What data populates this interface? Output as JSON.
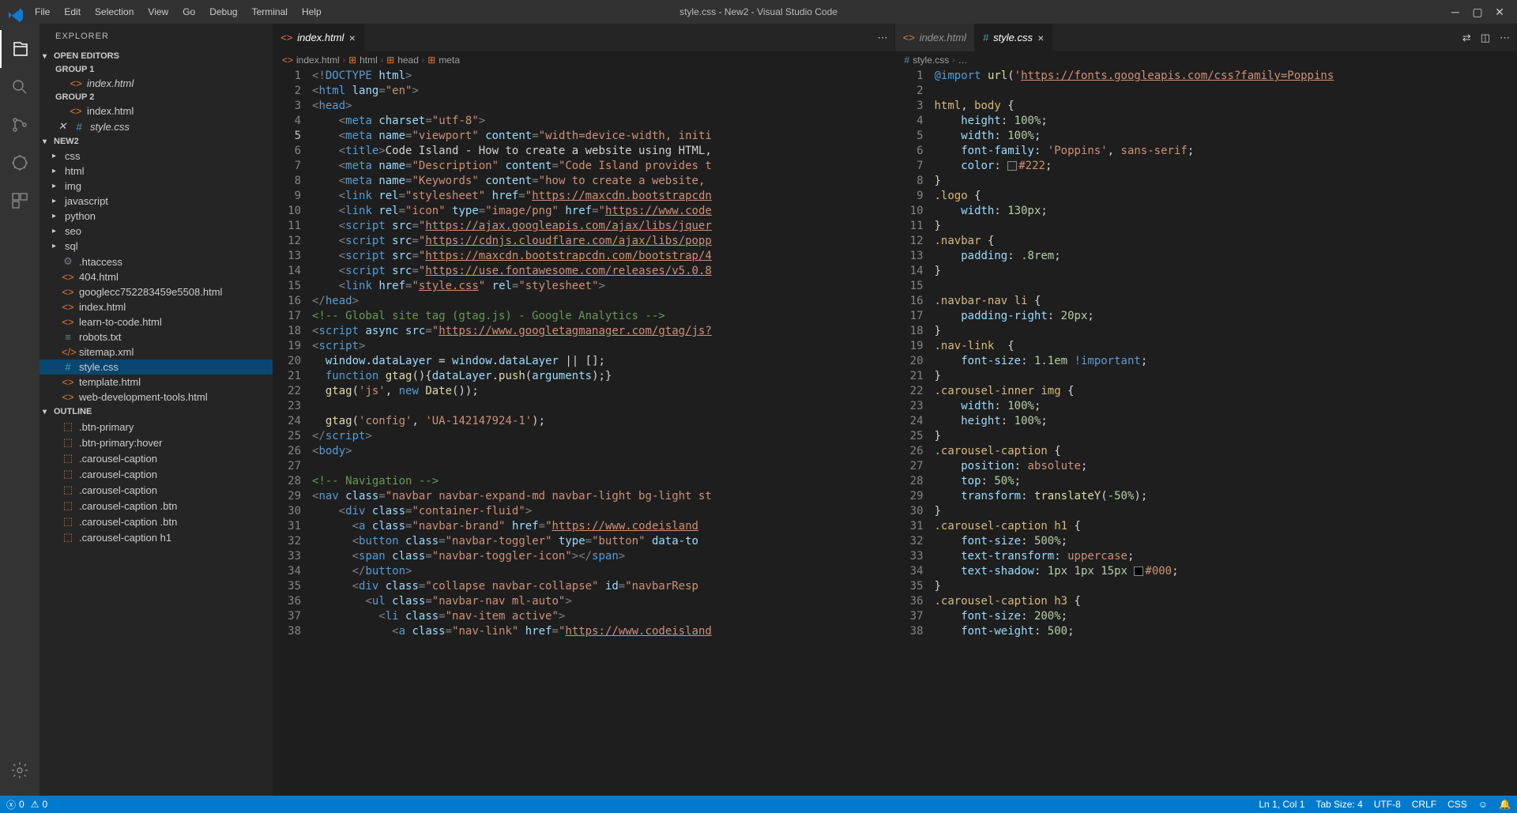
{
  "titlebar": {
    "title": "style.css - New2 - Visual Studio Code"
  },
  "menus": [
    "File",
    "Edit",
    "Selection",
    "View",
    "Go",
    "Debug",
    "Terminal",
    "Help"
  ],
  "sidebar": {
    "title": "EXPLORER",
    "open_editors": "OPEN EDITORS",
    "group1": "GROUP 1",
    "group2": "GROUP 2",
    "file1": "index.html",
    "file2": "index.html",
    "file3": "style.css",
    "folder": "NEW2",
    "folders": [
      "css",
      "html",
      "img",
      "javascript",
      "python",
      "seo",
      "sql"
    ],
    "files": [
      ".htaccess",
      "404.html",
      "googlecc752283459e5508.html",
      "index.html",
      "learn-to-code.html",
      "robots.txt",
      "sitemap.xml",
      "style.css",
      "template.html",
      "web-development-tools.html"
    ],
    "outline": "OUTLINE",
    "outline_items": [
      ".btn-primary",
      ".btn-primary:hover",
      ".carousel-caption",
      ".carousel-caption",
      ".carousel-caption",
      ".carousel-caption .btn",
      ".carousel-caption .btn",
      ".carousel-caption h1"
    ]
  },
  "editor1": {
    "tab": "index.html",
    "breadcrumbs": [
      "index.html",
      "html",
      "head",
      "meta"
    ]
  },
  "editor2": {
    "tab1": "index.html",
    "tab2": "style.css",
    "breadcrumb": "style.css"
  },
  "statusbar": {
    "errors": "0",
    "warnings": "0",
    "ln_col": "Ln 1, Col 1",
    "tab_size": "Tab Size: 4",
    "encoding": "UTF-8",
    "eol": "CRLF",
    "lang": "CSS"
  },
  "code_html": [
    {
      "n": 1,
      "h": "<span class='tok-punc'>&lt;!</span><span class='tok-doctype'>DOCTYPE</span> <span class='tok-attr'>html</span><span class='tok-punc'>&gt;</span>"
    },
    {
      "n": 2,
      "h": "<span class='tok-punc'>&lt;</span><span class='tok-tag'>html</span> <span class='tok-attr'>lang</span><span class='tok-punc'>=</span><span class='tok-str'>\"en\"</span><span class='tok-punc'>&gt;</span>"
    },
    {
      "n": 3,
      "h": "<span class='tok-punc'>&lt;</span><span class='tok-tag'>head</span><span class='tok-punc'>&gt;</span>"
    },
    {
      "n": 4,
      "h": "    <span class='tok-punc'>&lt;</span><span class='tok-tag'>meta</span> <span class='tok-attr'>charset</span><span class='tok-punc'>=</span><span class='tok-str'>\"utf-8\"</span><span class='tok-punc'>&gt;</span>"
    },
    {
      "n": 5,
      "h": "    <span class='tok-punc'>&lt;</span><span class='tok-tag'>meta</span> <span class='tok-attr'>name</span><span class='tok-punc'>=</span><span class='tok-str'>\"viewport\"</span> <span class='tok-attr'>content</span><span class='tok-punc'>=</span><span class='tok-str'>\"width=device-width, initi</span>",
      "cur": true
    },
    {
      "n": 6,
      "h": "    <span class='tok-punc'>&lt;</span><span class='tok-tag'>title</span><span class='tok-punc'>&gt;</span><span class='tok-text'>Code Island - How to create a website using HTML,</span>"
    },
    {
      "n": 7,
      "h": "    <span class='tok-punc'>&lt;</span><span class='tok-tag'>meta</span> <span class='tok-attr'>name</span><span class='tok-punc'>=</span><span class='tok-str'>\"Description\"</span> <span class='tok-attr'>content</span><span class='tok-punc'>=</span><span class='tok-str'>\"Code Island provides t</span>"
    },
    {
      "n": 8,
      "h": "    <span class='tok-punc'>&lt;</span><span class='tok-tag'>meta</span> <span class='tok-attr'>name</span><span class='tok-punc'>=</span><span class='tok-str'>\"Keywords\"</span> <span class='tok-attr'>content</span><span class='tok-punc'>=</span><span class='tok-str'>\"how to create a website, </span>"
    },
    {
      "n": 9,
      "h": "    <span class='tok-punc'>&lt;</span><span class='tok-tag'>link</span> <span class='tok-attr'>rel</span><span class='tok-punc'>=</span><span class='tok-str'>\"stylesheet\"</span> <span class='tok-attr'>href</span><span class='tok-punc'>=</span><span class='tok-str'>\"</span><span class='tok-url'>https://maxcdn.bootstrapcdn</span>"
    },
    {
      "n": 10,
      "h": "    <span class='tok-punc'>&lt;</span><span class='tok-tag'>link</span> <span class='tok-attr'>rel</span><span class='tok-punc'>=</span><span class='tok-str'>\"icon\"</span> <span class='tok-attr'>type</span><span class='tok-punc'>=</span><span class='tok-str'>\"image/png\"</span> <span class='tok-attr'>href</span><span class='tok-punc'>=</span><span class='tok-str'>\"</span><span class='tok-url'>https://www.code</span>"
    },
    {
      "n": 11,
      "h": "    <span class='tok-punc'>&lt;</span><span class='tok-tag'>script</span> <span class='tok-attr'>src</span><span class='tok-punc'>=</span><span class='tok-str'>\"</span><span class='tok-url'>https://ajax.googleapis.com/ajax/libs/jquer</span>"
    },
    {
      "n": 12,
      "h": "    <span class='tok-punc'>&lt;</span><span class='tok-tag'>script</span> <span class='tok-attr'>src</span><span class='tok-punc'>=</span><span class='tok-str'>\"</span><span class='tok-url'>https://cdnjs.cloudflare.com/ajax/libs/popp</span>"
    },
    {
      "n": 13,
      "h": "    <span class='tok-punc'>&lt;</span><span class='tok-tag'>script</span> <span class='tok-attr'>src</span><span class='tok-punc'>=</span><span class='tok-str'>\"</span><span class='tok-url'>https://maxcdn.bootstrapcdn.com/bootstrap/4</span>"
    },
    {
      "n": 14,
      "h": "    <span class='tok-punc'>&lt;</span><span class='tok-tag'>script</span> <span class='tok-attr'>src</span><span class='tok-punc'>=</span><span class='tok-str'>\"</span><span class='tok-url'>https://use.fontawesome.com/releases/v5.0.8</span>"
    },
    {
      "n": 15,
      "h": "    <span class='tok-punc'>&lt;</span><span class='tok-tag'>link</span> <span class='tok-attr'>href</span><span class='tok-punc'>=</span><span class='tok-str'>\"</span><span class='tok-url'>style.css</span><span class='tok-str'>\"</span> <span class='tok-attr'>rel</span><span class='tok-punc'>=</span><span class='tok-str'>\"stylesheet\"</span><span class='tok-punc'>&gt;</span>"
    },
    {
      "n": 16,
      "h": "<span class='tok-punc'>&lt;/</span><span class='tok-tag'>head</span><span class='tok-punc'>&gt;</span>"
    },
    {
      "n": 17,
      "h": "<span class='tok-comment'>&lt;!-- Global site tag (gtag.js) - Google Analytics --&gt;</span>"
    },
    {
      "n": 18,
      "h": "<span class='tok-punc'>&lt;</span><span class='tok-tag'>script</span> <span class='tok-attr'>async src</span><span class='tok-punc'>=</span><span class='tok-str'>\"</span><span class='tok-url'>https://www.googletagmanager.com/gtag/js?</span>"
    },
    {
      "n": 19,
      "h": "<span class='tok-punc'>&lt;</span><span class='tok-tag'>script</span><span class='tok-punc'>&gt;</span>"
    },
    {
      "n": 20,
      "h": "  <span class='tok-var'>window</span><span class='tok-text'>.</span><span class='tok-var'>dataLayer</span> <span class='tok-text'>=</span> <span class='tok-var'>window</span><span class='tok-text'>.</span><span class='tok-var'>dataLayer</span> <span class='tok-text'>|| [];</span>"
    },
    {
      "n": 21,
      "h": "  <span class='tok-kw'>function</span> <span class='tok-fn'>gtag</span><span class='tok-text'>(){</span><span class='tok-var'>dataLayer</span><span class='tok-text'>.</span><span class='tok-fn'>push</span><span class='tok-text'>(</span><span class='tok-var'>arguments</span><span class='tok-text'>);}</span>"
    },
    {
      "n": 22,
      "h": "  <span class='tok-fn'>gtag</span><span class='tok-text'>(</span><span class='tok-str'>'js'</span><span class='tok-text'>, </span><span class='tok-kw'>new</span> <span class='tok-fn'>Date</span><span class='tok-text'>());</span>"
    },
    {
      "n": 23,
      "h": ""
    },
    {
      "n": 24,
      "h": "  <span class='tok-fn'>gtag</span><span class='tok-text'>(</span><span class='tok-str'>'config'</span><span class='tok-text'>, </span><span class='tok-str'>'UA-142147924-1'</span><span class='tok-text'>);</span>"
    },
    {
      "n": 25,
      "h": "<span class='tok-punc'>&lt;/</span><span class='tok-tag'>script</span><span class='tok-punc'>&gt;</span>"
    },
    {
      "n": 26,
      "h": "<span class='tok-punc'>&lt;</span><span class='tok-tag'>body</span><span class='tok-punc'>&gt;</span>"
    },
    {
      "n": 27,
      "h": ""
    },
    {
      "n": 28,
      "h": "<span class='tok-comment'>&lt;!-- Navigation --&gt;</span>"
    },
    {
      "n": 29,
      "h": "<span class='tok-punc'>&lt;</span><span class='tok-tag'>nav</span> <span class='tok-attr'>class</span><span class='tok-punc'>=</span><span class='tok-str'>\"navbar navbar-expand-md navbar-light bg-light st</span>"
    },
    {
      "n": 30,
      "h": "    <span class='tok-punc'>&lt;</span><span class='tok-tag'>div</span> <span class='tok-attr'>class</span><span class='tok-punc'>=</span><span class='tok-str'>\"container-fluid\"</span><span class='tok-punc'>&gt;</span>"
    },
    {
      "n": 31,
      "h": "      <span class='tok-punc'>&lt;</span><span class='tok-tag'>a</span> <span class='tok-attr'>class</span><span class='tok-punc'>=</span><span class='tok-str'>\"navbar-brand\"</span> <span class='tok-attr'>href</span><span class='tok-punc'>=</span><span class='tok-str'>\"</span><span class='tok-url'>https://www.codeisland</span>"
    },
    {
      "n": 32,
      "h": "      <span class='tok-punc'>&lt;</span><span class='tok-tag'>button</span> <span class='tok-attr'>class</span><span class='tok-punc'>=</span><span class='tok-str'>\"navbar-toggler\"</span> <span class='tok-attr'>type</span><span class='tok-punc'>=</span><span class='tok-str'>\"button\"</span> <span class='tok-attr'>data-to</span>"
    },
    {
      "n": 33,
      "h": "      <span class='tok-punc'>&lt;</span><span class='tok-tag'>span</span> <span class='tok-attr'>class</span><span class='tok-punc'>=</span><span class='tok-str'>\"navbar-toggler-icon\"</span><span class='tok-punc'>&gt;&lt;/</span><span class='tok-tag'>span</span><span class='tok-punc'>&gt;</span>"
    },
    {
      "n": 34,
      "h": "      <span class='tok-punc'>&lt;/</span><span class='tok-tag'>button</span><span class='tok-punc'>&gt;</span>"
    },
    {
      "n": 35,
      "h": "      <span class='tok-punc'>&lt;</span><span class='tok-tag'>div</span> <span class='tok-attr'>class</span><span class='tok-punc'>=</span><span class='tok-str'>\"collapse navbar-collapse\"</span> <span class='tok-attr'>id</span><span class='tok-punc'>=</span><span class='tok-str'>\"navbarResp</span>"
    },
    {
      "n": 36,
      "h": "        <span class='tok-punc'>&lt;</span><span class='tok-tag'>ul</span> <span class='tok-attr'>class</span><span class='tok-punc'>=</span><span class='tok-str'>\"navbar-nav ml-auto\"</span><span class='tok-punc'>&gt;</span>"
    },
    {
      "n": 37,
      "h": "          <span class='tok-punc'>&lt;</span><span class='tok-tag'>li</span> <span class='tok-attr'>class</span><span class='tok-punc'>=</span><span class='tok-str'>\"nav-item active\"</span><span class='tok-punc'>&gt;</span>"
    },
    {
      "n": 38,
      "h": "            <span class='tok-punc'>&lt;</span><span class='tok-tag'>a</span> <span class='tok-attr'>class</span><span class='tok-punc'>=</span><span class='tok-str'>\"nav-link\"</span> <span class='tok-attr'>href</span><span class='tok-punc'>=</span><span class='tok-str'>\"</span><span class='tok-url'>https://www.codeisland</span>"
    }
  ],
  "code_css": [
    {
      "n": 1,
      "h": "<span class='tok-kw'>@import</span> <span class='tok-fn'>url</span><span class='tok-text'>(</span><span class='tok-str'>'</span><span class='tok-url'>https://fonts.googleapis.com/css?family=Poppins</span>"
    },
    {
      "n": 2,
      "h": ""
    },
    {
      "n": 3,
      "h": "<span class='tok-selector'>html</span><span class='tok-text'>, </span><span class='tok-selector'>body</span> <span class='tok-text'>{</span>"
    },
    {
      "n": 4,
      "h": "    <span class='tok-prop'>height</span><span class='tok-text'>: </span><span class='tok-num'>100%</span><span class='tok-text'>;</span>"
    },
    {
      "n": 5,
      "h": "    <span class='tok-prop'>width</span><span class='tok-text'>: </span><span class='tok-num'>100%</span><span class='tok-text'>;</span>"
    },
    {
      "n": 6,
      "h": "    <span class='tok-prop'>font-family</span><span class='tok-text'>: </span><span class='tok-str'>'Poppins'</span><span class='tok-text'>, </span><span class='tok-val'>sans-serif</span><span class='tok-text'>;</span>"
    },
    {
      "n": 7,
      "h": "    <span class='tok-prop'>color</span><span class='tok-text'>: </span><span class='colorbox' style='background:#222'></span><span class='tok-val'>#222</span><span class='tok-text'>;</span>"
    },
    {
      "n": 8,
      "h": "<span class='tok-text'>}</span>"
    },
    {
      "n": 9,
      "h": "<span class='tok-selector'>.logo</span> <span class='tok-text'>{</span>"
    },
    {
      "n": 10,
      "h": "    <span class='tok-prop'>width</span><span class='tok-text'>: </span><span class='tok-num'>130px</span><span class='tok-text'>;</span>"
    },
    {
      "n": 11,
      "h": "<span class='tok-text'>}</span>"
    },
    {
      "n": 12,
      "h": "<span class='tok-selector'>.navbar</span> <span class='tok-text'>{</span>"
    },
    {
      "n": 13,
      "h": "    <span class='tok-prop'>padding</span><span class='tok-text'>: </span><span class='tok-num'>.8rem</span><span class='tok-text'>;</span>"
    },
    {
      "n": 14,
      "h": "<span class='tok-text'>}</span>"
    },
    {
      "n": 15,
      "h": ""
    },
    {
      "n": 16,
      "h": "<span class='tok-selector'>.navbar-nav li</span> <span class='tok-text'>{</span>"
    },
    {
      "n": 17,
      "h": "    <span class='tok-prop'>padding-right</span><span class='tok-text'>: </span><span class='tok-num'>20px</span><span class='tok-text'>;</span>"
    },
    {
      "n": 18,
      "h": "<span class='tok-text'>}</span>"
    },
    {
      "n": 19,
      "h": "<span class='tok-selector'>.nav-link</span>  <span class='tok-text'>{</span>"
    },
    {
      "n": 20,
      "h": "    <span class='tok-prop'>font-size</span><span class='tok-text'>: </span><span class='tok-num'>1.1em</span> <span class='tok-important'>!important</span><span class='tok-text'>;</span>"
    },
    {
      "n": 21,
      "h": "<span class='tok-text'>}</span>"
    },
    {
      "n": 22,
      "h": "<span class='tok-selector'>.carousel-inner img</span> <span class='tok-text'>{</span>"
    },
    {
      "n": 23,
      "h": "    <span class='tok-prop'>width</span><span class='tok-text'>: </span><span class='tok-num'>100%</span><span class='tok-text'>;</span>"
    },
    {
      "n": 24,
      "h": "    <span class='tok-prop'>height</span><span class='tok-text'>: </span><span class='tok-num'>100%</span><span class='tok-text'>;</span>"
    },
    {
      "n": 25,
      "h": "<span class='tok-text'>}</span>"
    },
    {
      "n": 26,
      "h": "<span class='tok-selector'>.carousel-caption</span> <span class='tok-text'>{</span>"
    },
    {
      "n": 27,
      "h": "    <span class='tok-prop'>position</span><span class='tok-text'>: </span><span class='tok-val'>absolute</span><span class='tok-text'>;</span>"
    },
    {
      "n": 28,
      "h": "    <span class='tok-prop'>top</span><span class='tok-text'>: </span><span class='tok-num'>50%</span><span class='tok-text'>;</span>"
    },
    {
      "n": 29,
      "h": "    <span class='tok-prop'>transform</span><span class='tok-text'>: </span><span class='tok-fn'>translateY</span><span class='tok-text'>(</span><span class='tok-num'>-50%</span><span class='tok-text'>);</span>"
    },
    {
      "n": 30,
      "h": "<span class='tok-text'>}</span>"
    },
    {
      "n": 31,
      "h": "<span class='tok-selector'>.carousel-caption h1</span> <span class='tok-text'>{</span>"
    },
    {
      "n": 32,
      "h": "    <span class='tok-prop'>font-size</span><span class='tok-text'>: </span><span class='tok-num'>500%</span><span class='tok-text'>;</span>"
    },
    {
      "n": 33,
      "h": "    <span class='tok-prop'>text-transform</span><span class='tok-text'>: </span><span class='tok-val'>uppercase</span><span class='tok-text'>;</span>"
    },
    {
      "n": 34,
      "h": "    <span class='tok-prop'>text-shadow</span><span class='tok-text'>: </span><span class='tok-num'>1px 1px 15px</span> <span class='colorbox' style='background:#000'></span><span class='tok-val'>#000</span><span class='tok-text'>;</span>"
    },
    {
      "n": 35,
      "h": "<span class='tok-text'>}</span>"
    },
    {
      "n": 36,
      "h": "<span class='tok-selector'>.carousel-caption h3</span> <span class='tok-text'>{</span>"
    },
    {
      "n": 37,
      "h": "    <span class='tok-prop'>font-size</span><span class='tok-text'>: </span><span class='tok-num'>200%</span><span class='tok-text'>;</span>"
    },
    {
      "n": 38,
      "h": "    <span class='tok-prop'>font-weight</span><span class='tok-text'>: </span><span class='tok-num'>500</span><span class='tok-text'>;</span>"
    }
  ]
}
